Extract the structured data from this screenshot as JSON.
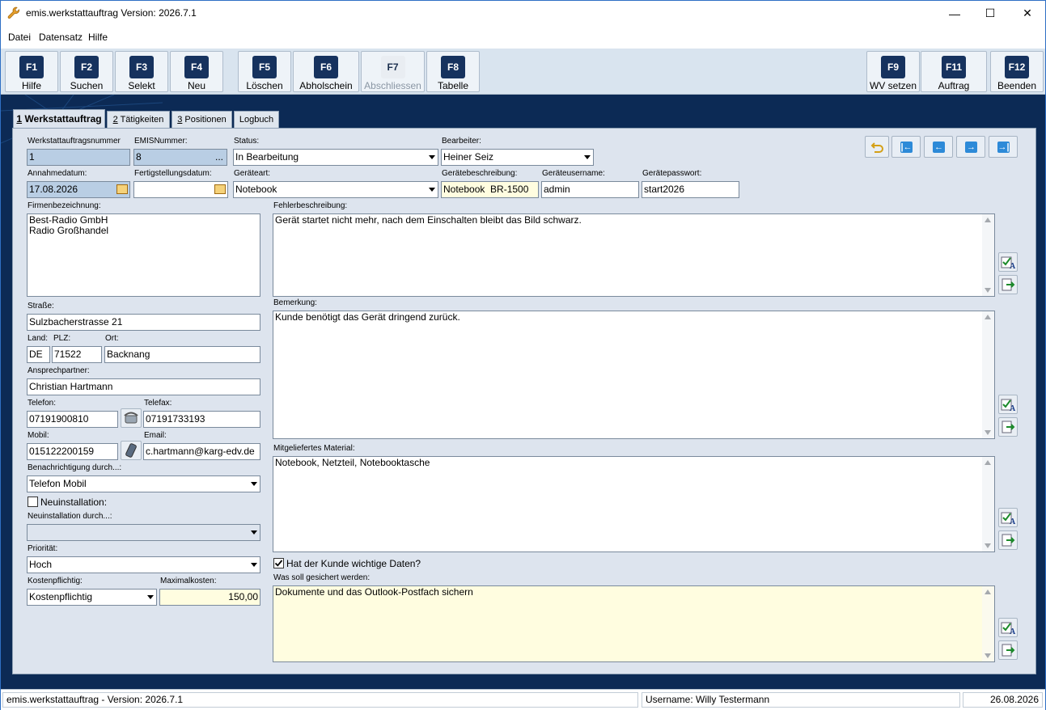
{
  "window": {
    "title": "emis.werkstattauftrag Version: 2026.7.1",
    "minimize": "—",
    "maximize": "☐",
    "close": "✕"
  },
  "menu": [
    "Datei",
    "Datensatz",
    "Hilfe"
  ],
  "toolbar": [
    {
      "key": "F1",
      "label": "Hilfe"
    },
    {
      "key": "F2",
      "label": "Suchen"
    },
    {
      "key": "F3",
      "label": "Selekt"
    },
    {
      "key": "F4",
      "label": "Neu"
    },
    {
      "key": "F5",
      "label": "Löschen"
    },
    {
      "key": "F6",
      "label": "Abholschein"
    },
    {
      "key": "F7",
      "label": "Abschliessen",
      "disabled": true
    },
    {
      "key": "F8",
      "label": "Tabelle"
    },
    {
      "key": "F9",
      "label": "WV setzen"
    },
    {
      "key": "F11",
      "label": "Auftrag"
    },
    {
      "key": "F12",
      "label": "Beenden"
    }
  ],
  "tabs": [
    {
      "num": "1",
      "label": "Werkstattauftrag",
      "active": true
    },
    {
      "num": "2",
      "label": "Tätigkeiten"
    },
    {
      "num": "3",
      "label": "Positionen"
    },
    {
      "num": "",
      "label": "Logbuch"
    }
  ],
  "form": {
    "werkstattauftragsnummer": {
      "label": "Werkstattauftragsnummer",
      "value": "1"
    },
    "emisnummer": {
      "label": "EMISNummer:",
      "value": "8",
      "button": "..."
    },
    "status": {
      "label": "Status:",
      "value": "In Bearbeitung"
    },
    "bearbeiter": {
      "label": "Bearbeiter:",
      "value": "Heiner Seiz"
    },
    "annahmedatum": {
      "label": "Annahmedatum:",
      "value": "17.08.2026"
    },
    "fertigstellungsdatum": {
      "label": "Fertigstellungsdatum:",
      "value": ""
    },
    "geraeteart": {
      "label": "Geräteart:",
      "value": "Notebook"
    },
    "geraetebeschreibung": {
      "label": "Gerätebeschreibung:",
      "value": "Notebook  BR-1500"
    },
    "geraeteusername": {
      "label": "Geräteusername:",
      "value": "admin"
    },
    "geraetepasswort": {
      "label": "Gerätepasswort:",
      "value": "start2026"
    },
    "firmenbezeichnung": {
      "label": "Firmenbezeichnung:",
      "value": "Best-Radio GmbH\nRadio Großhandel"
    },
    "strasse": {
      "label": "Straße:",
      "value": "Sulzbacherstrasse 21"
    },
    "land": {
      "label": "Land:",
      "value": "DE"
    },
    "plz": {
      "label": "PLZ:",
      "value": "71522"
    },
    "ort": {
      "label": "Ort:",
      "value": "Backnang"
    },
    "ansprechpartner": {
      "label": "Ansprechpartner:",
      "value": "Christian Hartmann"
    },
    "telefon": {
      "label": "Telefon:",
      "value": "07191900810"
    },
    "telefax": {
      "label": "Telefax:",
      "value": "07191733193"
    },
    "mobil": {
      "label": "Mobil:",
      "value": "015122200159"
    },
    "email": {
      "label": "Email:",
      "value": "c.hartmann@karg-edv.de"
    },
    "benachrichtigung": {
      "label": "Benachrichtigung durch...:",
      "value": "Telefon Mobil"
    },
    "neuinstallation": {
      "label": "Neuinstallation:",
      "checked": false
    },
    "neuinstallation_durch": {
      "label": "Neuinstallation durch...:",
      "value": ""
    },
    "prioritaet": {
      "label": "Priorität:",
      "value": "Hoch"
    },
    "kostenpflichtig": {
      "label": "Kostenpflichtig:",
      "value": "Kostenpflichtig"
    },
    "maximalkosten": {
      "label": "Maximalkosten:",
      "value": "150,00"
    },
    "fehlerbeschreibung": {
      "label": "Fehlerbeschreibung:",
      "value": "Gerät startet nicht mehr, nach dem Einschalten bleibt das Bild schwarz."
    },
    "bemerkung": {
      "label": "Bemerkung:",
      "value": "Kunde benötigt das Gerät dringend zurück."
    },
    "material": {
      "label": "Mitgeliefertes Material:",
      "value": "Notebook, Netzteil, Notebooktasche"
    },
    "wichtige_daten": {
      "label": "Hat der Kunde wichtige Daten?",
      "checked": true
    },
    "sicherung": {
      "label": "Was soll gesichert werden:",
      "value": "Dokumente und das Outlook-Postfach sichern"
    }
  },
  "status": {
    "left": "emis.werkstattauftrag - Version: 2026.7.1",
    "user": "Username: Willy Testermann",
    "date": "26.08.2026"
  },
  "colors": {
    "accent": "#16325e",
    "readonly": "#b9cee4",
    "highlight": "#fffde0",
    "background": "#0c2a55"
  }
}
